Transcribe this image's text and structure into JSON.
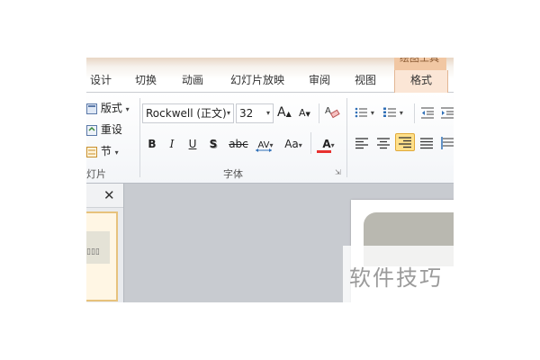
{
  "tabs": [
    "设计",
    "切换",
    "动画",
    "幻灯片放映",
    "审阅",
    "视图"
  ],
  "context_group_label": "绘图工具",
  "context_tab": "格式",
  "slides_group": {
    "layout_label": "版式",
    "reset_label": "重设",
    "section_label": "节",
    "group_label": "灯片"
  },
  "font_group": {
    "font_name": "Rockwell (正文)",
    "font_size": "32",
    "grow_font": "A",
    "shrink_font": "A",
    "clear_format": "A",
    "bold": "B",
    "italic": "I",
    "underline": "U",
    "shadow": "S",
    "strikethrough": "abc",
    "char_spacing": "AV",
    "change_case": "Aa",
    "font_color": "A",
    "group_label": "字体"
  },
  "paragraph_group": {
    "active_alignment": "right"
  },
  "colors": {
    "context_tab": "#fbe6d6",
    "font_color_bar": "#e8312f",
    "selected_button": "#ffe08a"
  },
  "watermark": "软件技巧"
}
